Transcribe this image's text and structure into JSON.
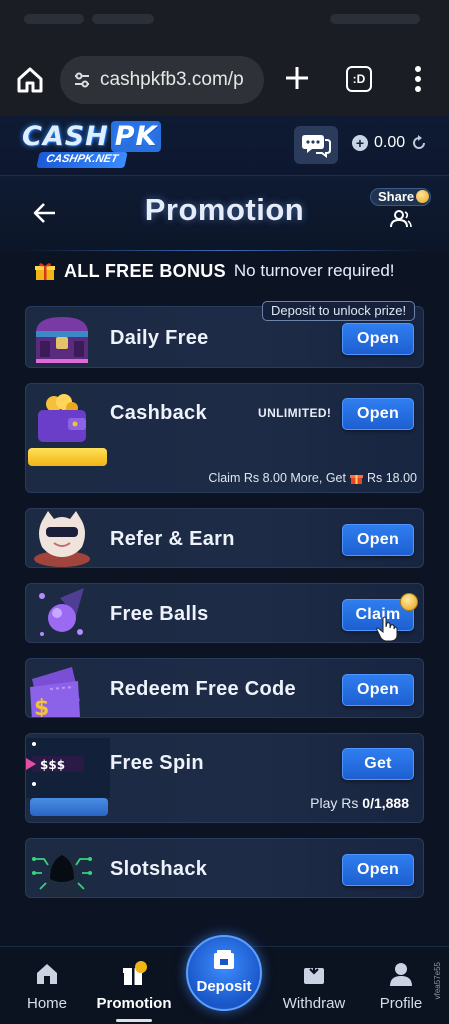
{
  "browser": {
    "url": "cashpkfb3.com/p",
    "tab_count_label": ":D"
  },
  "site": {
    "logo_top": "CASH",
    "logo_top_accent": "PK",
    "logo_bottom": "CASHPK.NET",
    "balance": "0.00"
  },
  "page": {
    "title": "Promotion",
    "share_label": "Share"
  },
  "bonus_banner": {
    "title": "ALL FREE BONUS",
    "note": "No turnover required!"
  },
  "cards": [
    {
      "label": "Daily Free",
      "button": "Open",
      "tag": "Deposit to unlock prize!",
      "icon": "treasure-chest-icon"
    },
    {
      "label": "Cashback",
      "button": "Open",
      "tag": "UNLIMITED!",
      "note_prefix": "Claim Rs 8.00 More, Get",
      "note_suffix": "Rs 18.00",
      "progress": 0,
      "icon": "wallet-coins-icon"
    },
    {
      "label": "Refer & Earn",
      "button": "Open",
      "icon": "cat-mascot-icon"
    },
    {
      "label": "Free Balls",
      "button": "Claim",
      "icon": "ball-icon"
    },
    {
      "label": "Redeem Free Code",
      "button": "Open",
      "icon": "ticket-icon"
    },
    {
      "label": "Free Spin",
      "button": "Get",
      "banner": "$$$",
      "play_prefix": "Play Rs",
      "play_value": "0/1,888",
      "progress": 0,
      "icon": "spin-banner-icon"
    },
    {
      "label": "Slotshack",
      "button": "Open",
      "icon": "hacker-icon"
    }
  ],
  "nav": {
    "home": "Home",
    "promotion": "Promotion",
    "deposit": "Deposit",
    "withdraw": "Withdraw",
    "profile": "Profile",
    "active": "promotion"
  },
  "side_text": "vfea57e55",
  "colors": {
    "background": "#0c1424",
    "card": "#1d2b46",
    "button": "#2a6fe0",
    "coin": "#f2b515"
  }
}
